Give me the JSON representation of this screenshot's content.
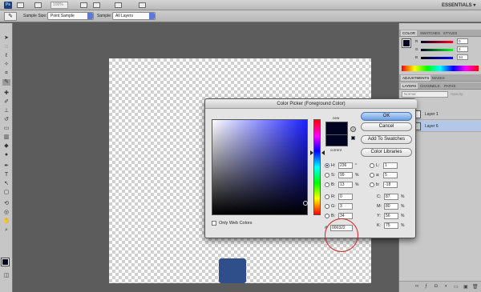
{
  "app": {
    "logo": "Ps",
    "zoom": "100%",
    "workspace": "ESSENTIALS ▾"
  },
  "options_bar": {
    "sample_size_label": "Sample Size:",
    "sample_size_value": "Point Sample",
    "sample_label": "Sample:",
    "sample_value": "All Layers"
  },
  "panels": {
    "color_tabs": [
      "COLOR",
      "SWATCHES",
      "STYLES"
    ],
    "color_sliders": [
      {
        "label": "R",
        "value": "0"
      },
      {
        "label": "G",
        "value": "3"
      },
      {
        "label": "B",
        "value": "34"
      }
    ],
    "adjustment_tabs": [
      "ADJUSTMENTS",
      "MASKS"
    ],
    "layer_tabs": [
      "LAYERS",
      "CHANNELS",
      "PATHS"
    ],
    "blend_mode": "Normal",
    "opacity_label": "Opacity:",
    "layers": [
      "Layer 1",
      "Layer 6"
    ]
  },
  "color_picker": {
    "title": "Color Picker (Foreground Color)",
    "new_label": "new",
    "current_label": "current",
    "buttons": {
      "ok": "OK",
      "cancel": "Cancel",
      "add_swatches": "Add To Swatches",
      "color_libraries": "Color Libraries"
    },
    "only_web_colors": "Only Web Colors",
    "hsb": [
      {
        "label": "H:",
        "value": "236",
        "unit": "°",
        "selected": true
      },
      {
        "label": "S:",
        "value": "99",
        "unit": "%"
      },
      {
        "label": "B:",
        "value": "13",
        "unit": "%"
      }
    ],
    "rgb": [
      {
        "label": "R:",
        "value": "0"
      },
      {
        "label": "G:",
        "value": "3"
      },
      {
        "label": "B:",
        "value": "34"
      }
    ],
    "lab": [
      {
        "label": "L:",
        "value": "1"
      },
      {
        "label": "a:",
        "value": "5"
      },
      {
        "label": "b:",
        "value": "-18"
      }
    ],
    "cmyk": [
      {
        "label": "C:",
        "value": "87",
        "unit": "%"
      },
      {
        "label": "M:",
        "value": "80",
        "unit": "%"
      },
      {
        "label": "Y:",
        "value": "56",
        "unit": "%"
      },
      {
        "label": "K:",
        "value": "75",
        "unit": "%"
      }
    ],
    "hex_label": "#",
    "hex_value": "000322",
    "color": "#000322"
  }
}
